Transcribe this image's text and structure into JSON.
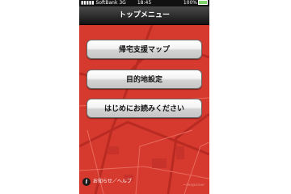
{
  "status_bar": {
    "carrier": "SoftBank",
    "network": "3G",
    "time": "18:45",
    "battery": "100%"
  },
  "nav": {
    "title": "トップメニュー"
  },
  "menu": {
    "items": [
      {
        "label": "帰宅支援マップ"
      },
      {
        "label": "目的地設定"
      },
      {
        "label": "はじめにお読みください"
      }
    ]
  },
  "footer": {
    "icon": "info-icon",
    "label": "お知らせ／ヘルプ"
  },
  "colors": {
    "background": "#d63a2e",
    "navbar": "#1a1a1a",
    "button": "#e6e6e6"
  }
}
